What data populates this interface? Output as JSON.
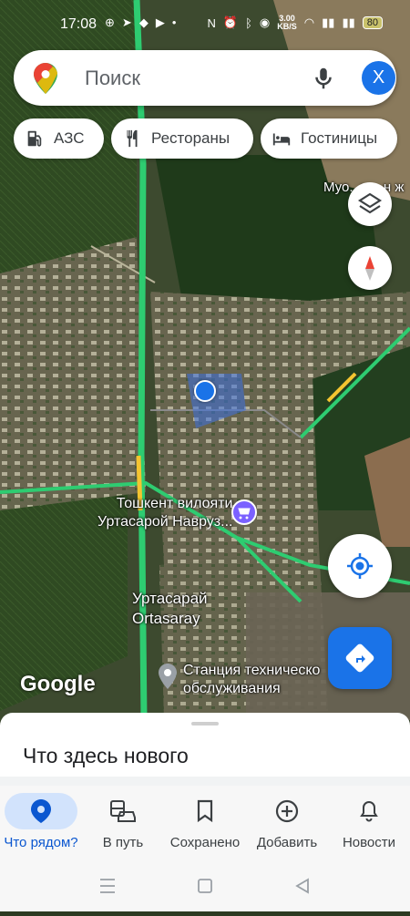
{
  "status_bar": {
    "time": "17:08",
    "net_speed_value": "3.00",
    "net_speed_unit": "KB/S",
    "battery": "80"
  },
  "search": {
    "placeholder": "Поиск",
    "avatar_letter": "X"
  },
  "chips": [
    {
      "label": "АЗС",
      "icon": "gas-station-icon"
    },
    {
      "label": "Рестораны",
      "icon": "restaurant-icon"
    },
    {
      "label": "Гостиницы",
      "icon": "hotel-icon"
    }
  ],
  "map": {
    "labels": {
      "top_right": "Муо...и... н ж",
      "shop_line1": "Тошкент вилояти",
      "shop_line2": "Уртасарой Навруз...",
      "town_line1": "Уртасарай",
      "town_line2": "Ortasaray",
      "service_line1": "Станция техническо",
      "service_line2": "обслуживания"
    },
    "google_logo": "Google"
  },
  "sheet": {
    "title": "Что здесь нового"
  },
  "nav": [
    {
      "label": "Что рядом?",
      "icon": "location-pin-icon",
      "active": true
    },
    {
      "label": "В путь",
      "icon": "commute-icon",
      "active": false
    },
    {
      "label": "Сохранено",
      "icon": "bookmark-icon",
      "active": false
    },
    {
      "label": "Добавить",
      "icon": "add-circle-icon",
      "active": false
    },
    {
      "label": "Новости",
      "icon": "bell-icon",
      "active": false
    }
  ],
  "colors": {
    "accent": "#1a73e8",
    "road_green": "#2ecc71",
    "road_yellow": "#f4c430"
  }
}
